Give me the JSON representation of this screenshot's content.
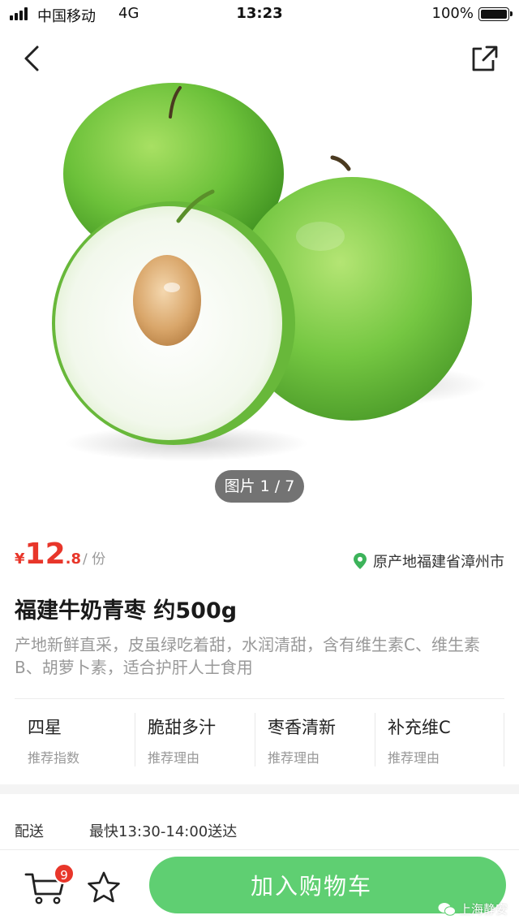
{
  "status_bar": {
    "carrier": "中国移动",
    "network": "4G",
    "time": "13:23",
    "battery": "100%"
  },
  "hero": {
    "image_alt": "green jujube fruits, one cut in half",
    "page_indicator": "图片 1 / 7"
  },
  "product": {
    "price": {
      "currency": "¥",
      "integer": "12",
      "decimal": ".8",
      "unit": "/ 份"
    },
    "origin": "原产地福建省漳州市",
    "title": "福建牛奶青枣 约500g",
    "description": "产地新鲜直采，皮虽绿吃着甜，水润清甜，含有维生素C、维生素B、胡萝卜素，适合护肝人士食用",
    "tags": [
      {
        "title": "四星",
        "subtitle": "推荐指数"
      },
      {
        "title": "脆甜多汁",
        "subtitle": "推荐理由"
      },
      {
        "title": "枣香清新",
        "subtitle": "推荐理由"
      },
      {
        "title": "补充维C",
        "subtitle": "推荐理由"
      }
    ]
  },
  "delivery": {
    "label": "配送",
    "value": "最快13:30-14:00送达"
  },
  "bottom_bar": {
    "cart_count": "9",
    "add_to_cart_label": "加入购物车",
    "watermark": "上海静安"
  },
  "colors": {
    "price_red": "#e8362a",
    "button_green": "#5fcf72",
    "pin_green": "#3cb35a"
  },
  "icons": {
    "back": "chevron-left-icon",
    "share": "share-icon",
    "location": "location-pin-icon",
    "cart": "cart-icon",
    "favorite": "star-icon"
  }
}
